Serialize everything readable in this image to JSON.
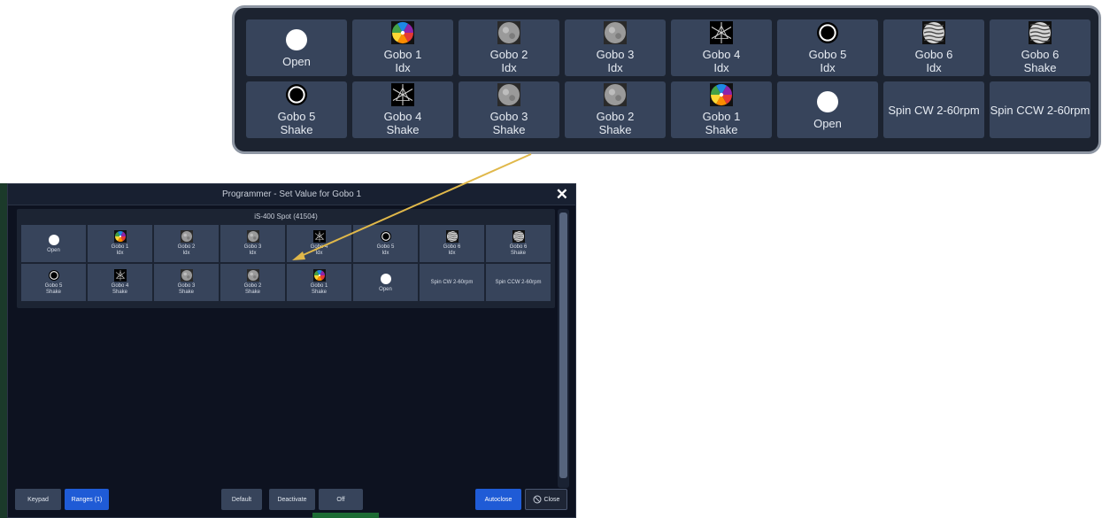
{
  "zoom": {
    "row1": [
      {
        "label": "Open",
        "icon": "white-disc-icon"
      },
      {
        "label": "Gobo 1\nIdx",
        "icon": "color-wheel-gobo-icon"
      },
      {
        "label": "Gobo 2\nIdx",
        "icon": "gray-texture-gobo-icon"
      },
      {
        "label": "Gobo 3\nIdx",
        "icon": "gray-texture-gobo-icon"
      },
      {
        "label": "Gobo 4\nIdx",
        "icon": "star-pattern-gobo-icon"
      },
      {
        "label": "Gobo 5\nIdx",
        "icon": "ring-gobo-icon"
      },
      {
        "label": "Gobo 6\nIdx",
        "icon": "wave-pattern-gobo-icon"
      },
      {
        "label": "Gobo 6\nShake",
        "icon": "wave-pattern-gobo-icon"
      }
    ],
    "row2": [
      {
        "label": "Gobo 5\nShake",
        "icon": "ring-gobo-icon"
      },
      {
        "label": "Gobo 4\nShake",
        "icon": "star-pattern-gobo-icon"
      },
      {
        "label": "Gobo 3\nShake",
        "icon": "gray-texture-gobo-icon"
      },
      {
        "label": "Gobo 2\nShake",
        "icon": "gray-texture-gobo-icon"
      },
      {
        "label": "Gobo 1\nShake",
        "icon": "color-wheel-gobo-icon"
      },
      {
        "label": "Open",
        "icon": "white-disc-icon"
      },
      {
        "label": "Spin CW 2-60rpm",
        "icon": ""
      },
      {
        "label": "Spin CCW 2-60rpm",
        "icon": ""
      }
    ]
  },
  "dialog": {
    "title": "Programmer - Set Value for Gobo 1",
    "close_glyph": "✕",
    "fixture": "iS-400 Spot (41504)",
    "row1": [
      {
        "label": "Open",
        "icon": "white-disc-icon"
      },
      {
        "label": "Gobo 1\nIdx",
        "icon": "color-wheel-gobo-icon"
      },
      {
        "label": "Gobo 2\nIdx",
        "icon": "gray-texture-gobo-icon"
      },
      {
        "label": "Gobo 3\nIdx",
        "icon": "gray-texture-gobo-icon"
      },
      {
        "label": "Gobo 4\nIdx",
        "icon": "star-pattern-gobo-icon"
      },
      {
        "label": "Gobo 5\nIdx",
        "icon": "ring-gobo-icon"
      },
      {
        "label": "Gobo 6\nIdx",
        "icon": "wave-pattern-gobo-icon"
      },
      {
        "label": "Gobo 6\nShake",
        "icon": "wave-pattern-gobo-icon"
      }
    ],
    "row2": [
      {
        "label": "Gobo 5\nShake",
        "icon": "ring-gobo-icon"
      },
      {
        "label": "Gobo 4\nShake",
        "icon": "star-pattern-gobo-icon"
      },
      {
        "label": "Gobo 3\nShake",
        "icon": "gray-texture-gobo-icon"
      },
      {
        "label": "Gobo 2\nShake",
        "icon": "gray-texture-gobo-icon"
      },
      {
        "label": "Gobo 1\nShake",
        "icon": "color-wheel-gobo-icon"
      },
      {
        "label": "Open",
        "icon": "white-disc-icon"
      },
      {
        "label": "Spin CW 2-60rpm",
        "icon": ""
      },
      {
        "label": "Spin CCW 2-60rpm",
        "icon": ""
      }
    ],
    "footer": {
      "keypad": "Keypad",
      "ranges": "Ranges (1)",
      "default": "Default",
      "deactivate": "Deactivate",
      "off": "Off",
      "autoclose": "Autoclose",
      "close": "Close"
    }
  },
  "colors": {
    "accent_blue": "#1f5bd6",
    "button_bg": "#37445b",
    "arrow": "#e0b84a"
  }
}
